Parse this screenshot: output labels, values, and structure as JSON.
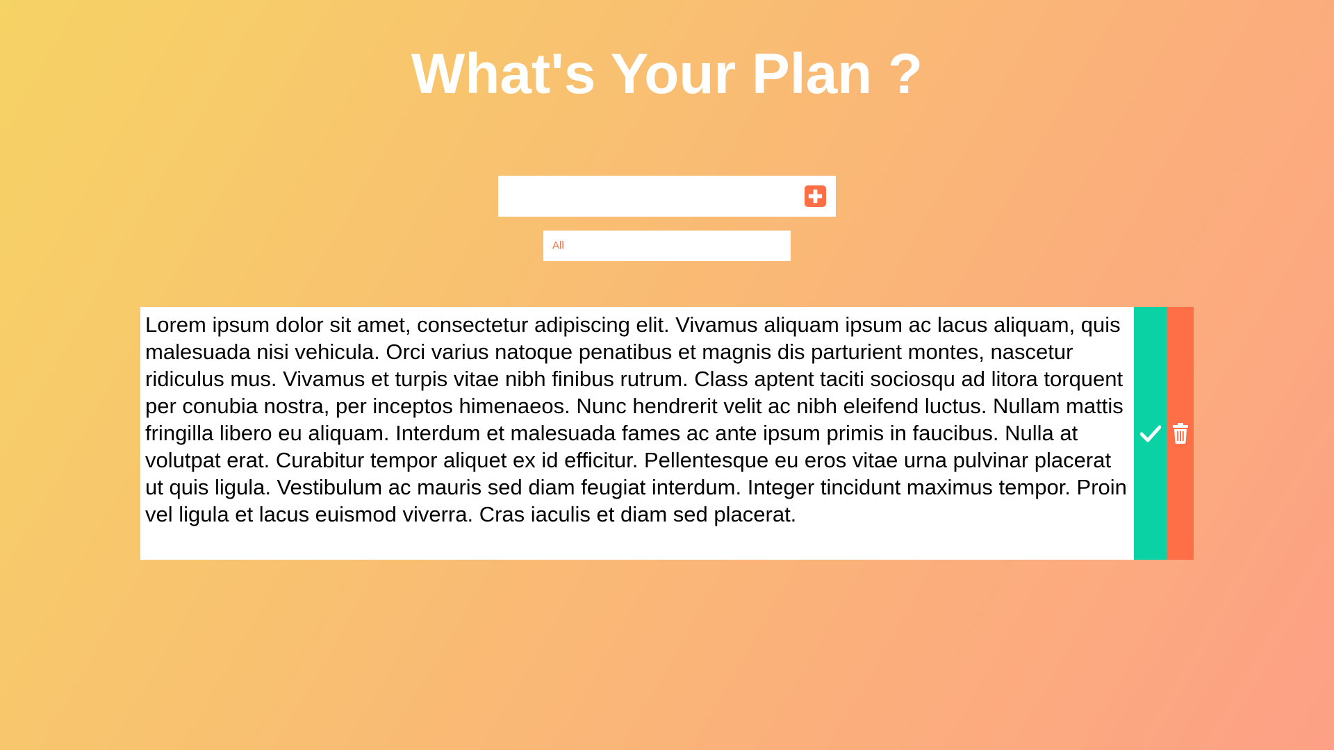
{
  "header": {
    "title": "What's Your Plan ?"
  },
  "form": {
    "input_value": "",
    "input_placeholder": "",
    "add_icon": "plus-square-icon"
  },
  "filter": {
    "selected": "All"
  },
  "todos": [
    {
      "text": "Lorem ipsum dolor sit amet, consectetur adipiscing elit. Vivamus aliquam ipsum ac lacus aliquam, quis malesuada nisi vehicula. Orci varius natoque penatibus et magnis dis parturient montes, nascetur ridiculus mus. Vivamus et turpis vitae nibh finibus rutrum. Class aptent taciti sociosqu ad litora torquent per conubia nostra, per inceptos himenaeos. Nunc hendrerit velit ac nibh eleifend luctus. Nullam mattis fringilla libero eu aliquam. Interdum et malesuada fames ac ante ipsum primis in faucibus. Nulla at volutpat erat. Curabitur tempor aliquet ex id efficitur. Pellentesque eu eros vitae urna pulvinar placerat ut quis ligula. Vestibulum ac mauris sed diam feugiat interdum. Integer tincidunt maximus tempor. Proin vel ligula et lacus euismod viverra. Cras iaculis et diam sed placerat.",
      "complete_icon": "check-icon",
      "delete_icon": "trash-icon"
    }
  ],
  "colors": {
    "background_start": "#f6d365",
    "background_end": "#fda085",
    "accent": "#ff6f47",
    "complete": "#0bd2a4",
    "surface": "#ffffff"
  }
}
